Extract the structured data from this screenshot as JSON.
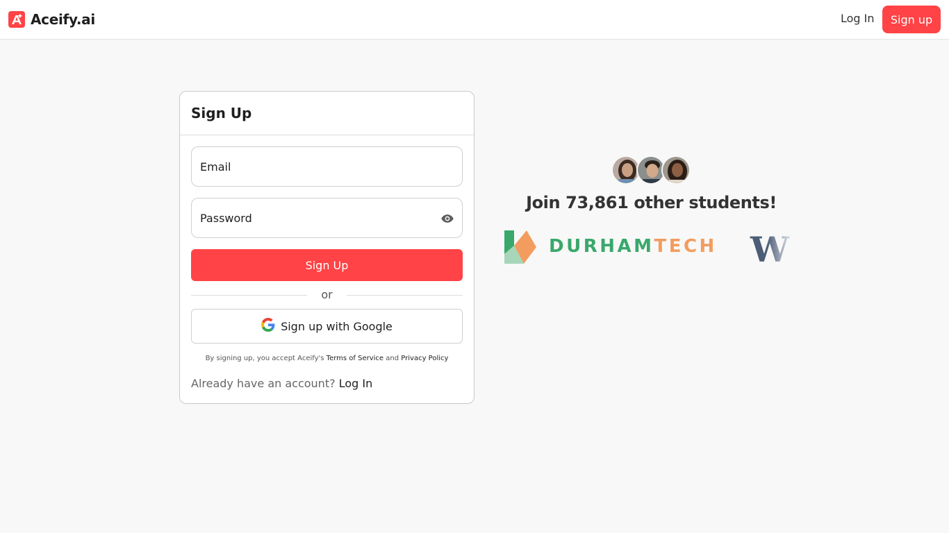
{
  "header": {
    "logo_text": "Aceify.ai",
    "logo_icon": "a-plus-icon",
    "login_label": "Log In",
    "signup_label": "Sign up",
    "brand_color": "#ff4346"
  },
  "form": {
    "title": "Sign Up",
    "email_placeholder": "Email",
    "password_placeholder": "Password",
    "eye_icon": "eye-icon",
    "submit_label": "Sign Up",
    "divider_text": "or",
    "google_label": "Sign up with Google",
    "terms_prefix": "By signing up, you accept Aceify's",
    "terms_link": "Terms of Service",
    "terms_and": "and",
    "privacy_link": "Privacy Policy",
    "already_text": "Already have an account?",
    "login_link": "Log In"
  },
  "social_proof": {
    "headline": "Join 73,861 other students!",
    "avatars": [
      "avatar-student-1",
      "avatar-student-2",
      "avatar-student-3"
    ],
    "logos": {
      "durham_part1": "DURHAM",
      "durham_part2": "TECH",
      "w_logo": "W"
    }
  }
}
